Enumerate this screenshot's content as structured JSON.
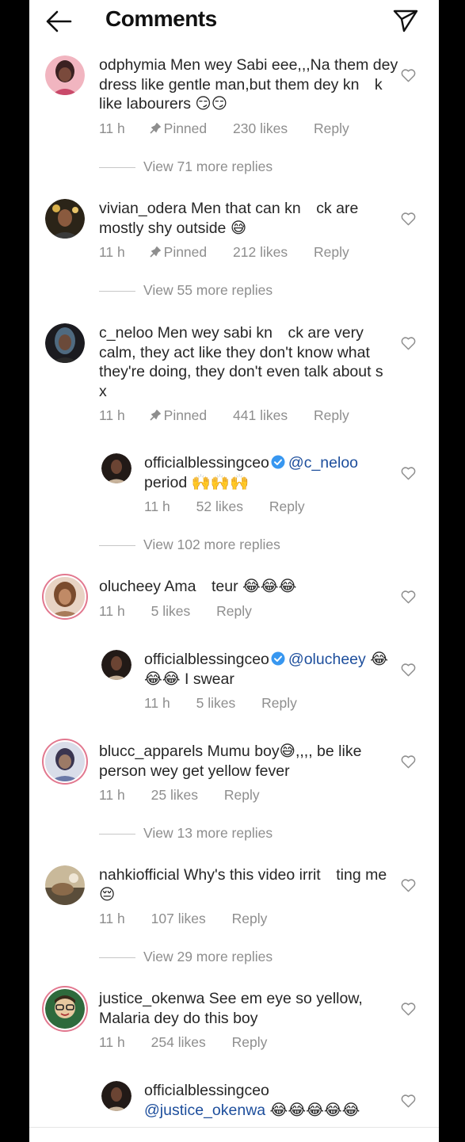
{
  "header": {
    "title": "Comments"
  },
  "comments": [
    {
      "username": "odphymia",
      "text": "Men wey Sabi eee,,,Na them dey dress like gentle man,but them dey kn k like labourers 😏😏",
      "time": "11 h",
      "pinned": "Pinned",
      "likes": "230 likes",
      "reply": "Reply",
      "view_more": "View 71 more replies",
      "avatar_colors": [
        "#4a2b2b",
        "#d98c98"
      ]
    },
    {
      "username": "vivian_odera",
      "text": "Men that can kn ck are mostly shy outside 😅",
      "time": "11 h",
      "pinned": "Pinned",
      "likes": "212 likes",
      "reply": "Reply",
      "view_more": "View 55 more replies",
      "avatar_colors": [
        "#2b2418",
        "#b99a55"
      ]
    },
    {
      "username": "c_neloo",
      "text": "Men wey sabi kn ck are very calm, they act like they don't know what they're doing, they don't even talk about s x",
      "time": "11 h",
      "pinned": "Pinned",
      "likes": "441 likes",
      "reply": "Reply",
      "avatar_colors": [
        "#1b1b20",
        "#6a7f92"
      ],
      "reply_item": {
        "username": "officialblessingceo",
        "mention": "@c_neloo",
        "text": "period 🙌🙌🙌",
        "time": "11 h",
        "likes": "52 likes",
        "reply": "Reply"
      },
      "view_more": "View 102 more replies"
    },
    {
      "username": "olucheey",
      "text": "Ama teur 😂😂😂",
      "time": "11 h",
      "likes": "5 likes",
      "reply": "Reply",
      "avatar_colors": [
        "#b7876a",
        "#f0d2c0"
      ],
      "reply_item": {
        "username": "officialblessingceo",
        "mention": "@olucheey",
        "text": "😂😂😂 I swear",
        "time": "11 h",
        "likes": "5 likes",
        "reply": "Reply"
      }
    },
    {
      "username": "blucc_apparels",
      "text": "Mumu boy😅,,,, be like person wey get yellow fever",
      "time": "11 h",
      "likes": "25 likes",
      "reply": "Reply",
      "view_more": "View 13 more replies",
      "avatar_colors": [
        "#6a79a8",
        "#d9dde9"
      ]
    },
    {
      "username": "nahkiofficial",
      "text": "Why's this video irrit ting me 😔",
      "time": "11 h",
      "likes": "107 likes",
      "reply": "Reply",
      "view_more": "View 29 more replies",
      "avatar_colors": [
        "#5a4d3a",
        "#c9b99a"
      ]
    },
    {
      "username": "justice_okenwa",
      "text": "See em eye so yellow, Malaria dey do this boy",
      "time": "11 h",
      "likes": "254 likes",
      "reply": "Reply",
      "avatar_colors": [
        "#2e6a3c",
        "#e8c9a0"
      ],
      "reply_item": {
        "username": "officialblessingceo",
        "mention": "@justice_okenwa",
        "text": "😂😂😂😂😂"
      }
    }
  ],
  "colors": {
    "accent_blue": "#1d4e9c",
    "verified_blue": "#3897f0",
    "meta_gray": "#8e8e8e",
    "story_ring": "#e2788f"
  },
  "icons": {
    "back": "arrow-left-icon",
    "send": "paper-plane-icon",
    "like": "heart-outline-icon",
    "pin": "pin-icon",
    "verified": "verified-badge-icon"
  }
}
